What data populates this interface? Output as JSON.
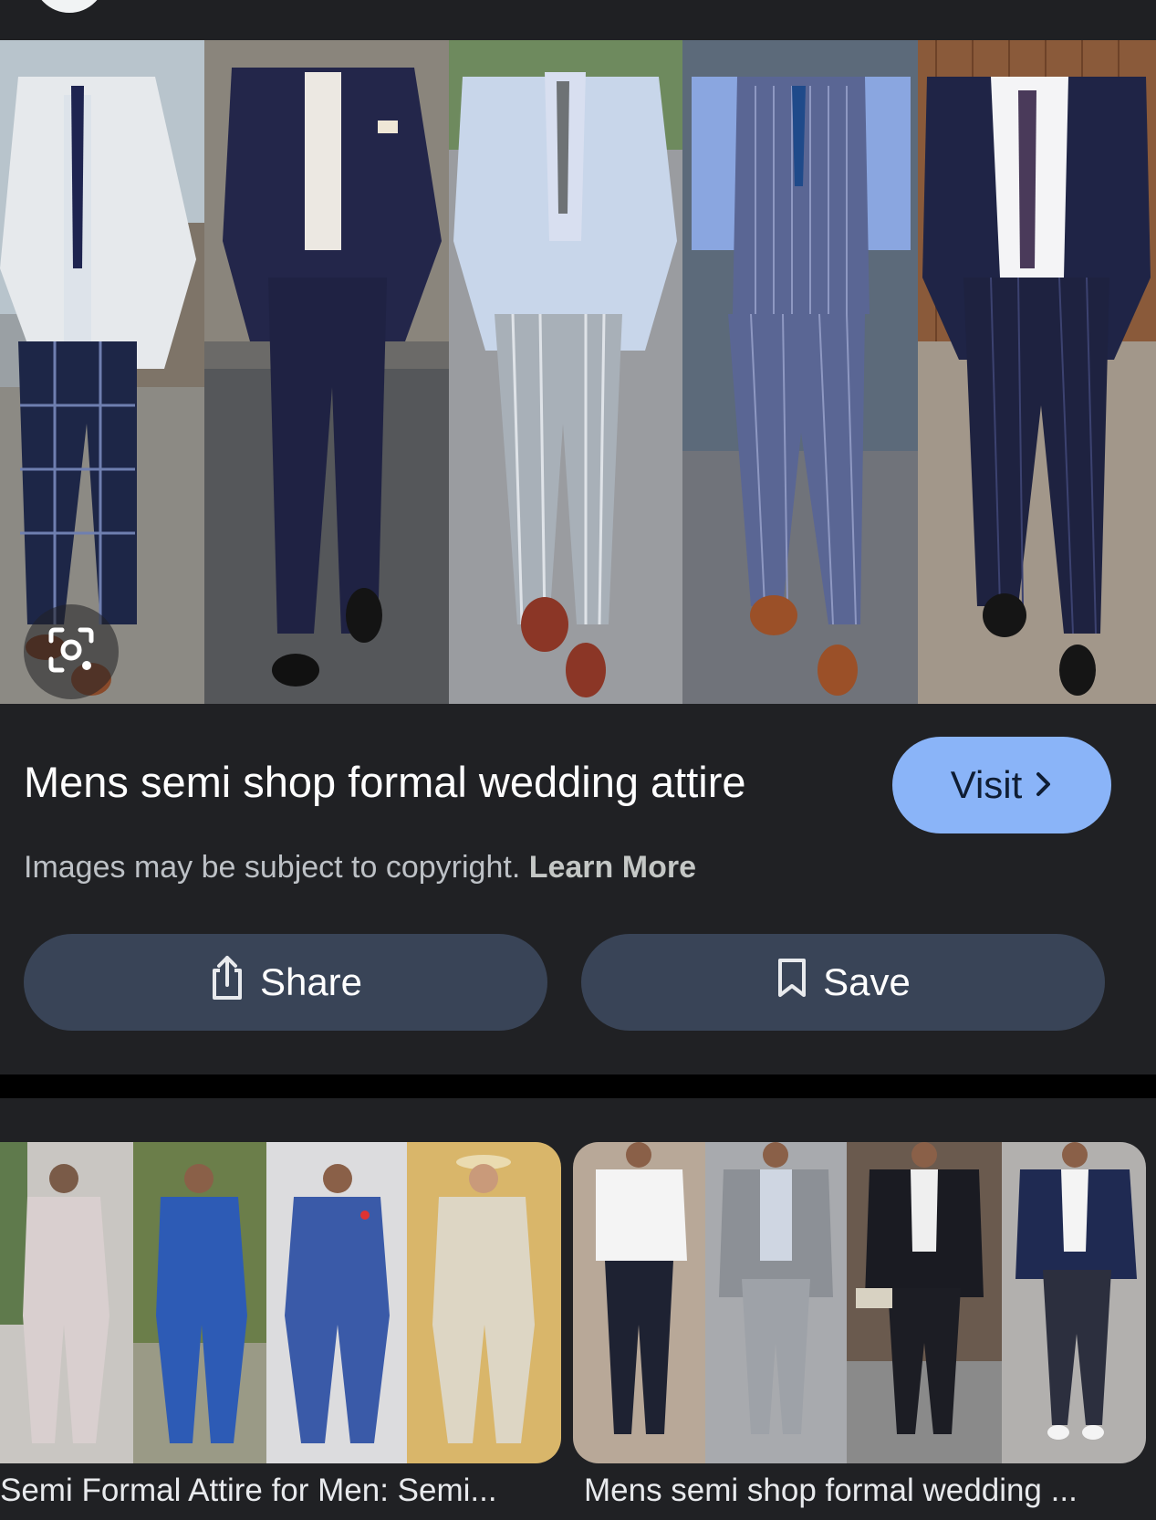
{
  "result": {
    "title": "Mens semi shop formal wedding attire",
    "visit_label": "Visit",
    "copyright_text": "Images may be subject to copyright.",
    "learn_more_label": "Learn More",
    "share_label": "Share",
    "save_label": "Save"
  },
  "related": [
    {
      "caption": "Semi Formal Attire for Men: Semi..."
    },
    {
      "caption": "Mens semi shop formal wedding ..."
    }
  ],
  "icons": {
    "lens": "lens-icon",
    "visit": "chevron-right-icon",
    "share": "share-icon",
    "save": "bookmark-icon"
  },
  "colors": {
    "background": "#202124",
    "visit_button": "#8ab4f8",
    "action_button": "#394457"
  }
}
